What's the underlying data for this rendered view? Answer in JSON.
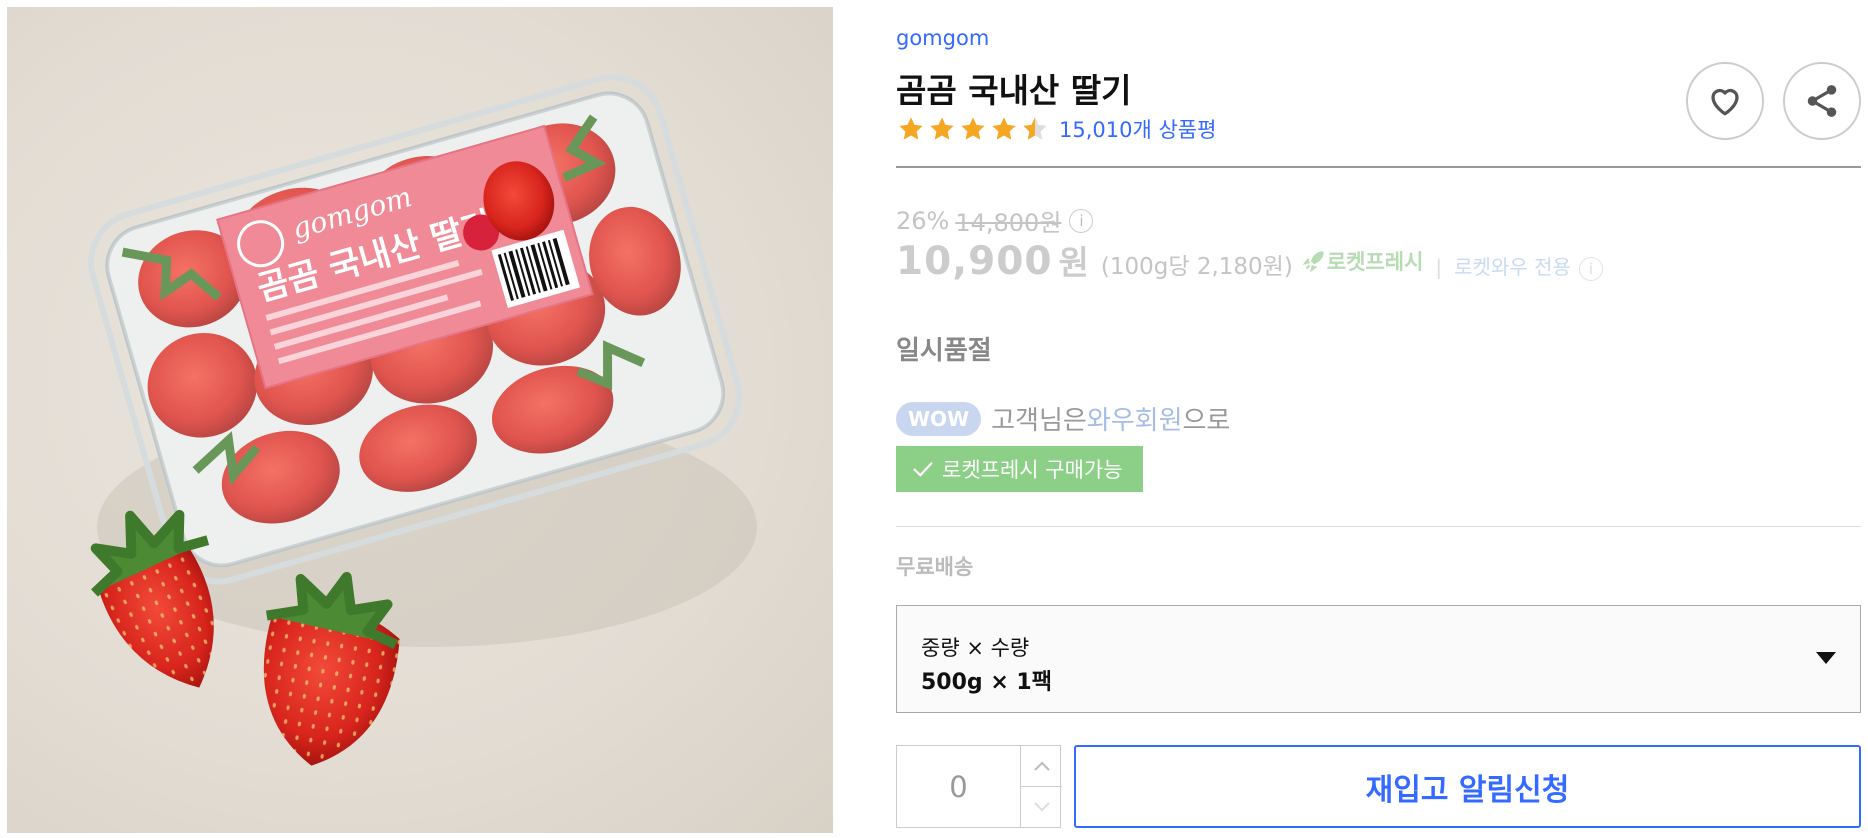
{
  "product_image": {
    "alt": "곰곰 국내산 딸기 500g 상품 이미지"
  },
  "product": {
    "brand": "gomgom",
    "title": "곰곰 국내산 딸기",
    "rating": 4.5,
    "review_count": "15,010개 상품평"
  },
  "price": {
    "discount_rate": "26%",
    "original_price": "14,800원",
    "info_icon": "i",
    "sale_price": "10,900",
    "won": "원",
    "unit_price": "(100g당 2,180원)",
    "rocket_fresh": "로켓프레시",
    "wow_only": "로켓와우 전용"
  },
  "status": {
    "soldout": "일시품절"
  },
  "wow": {
    "badge": "WOW",
    "text_before": "고객님은 ",
    "member": "와우회원",
    "text_after": "으로"
  },
  "fresh_available": "로켓프레시 구매가능",
  "shipping": "무료배송",
  "option": {
    "label": "중량 × 수량",
    "value": "500g × 1팩"
  },
  "quantity": {
    "value": "0"
  },
  "restock_button": "재입고 알림신청",
  "colors": {
    "brand_blue": "#346aff",
    "star": "#f5a623",
    "fresh_green": "#8ccf86"
  },
  "icons": [
    "heart-icon",
    "share-icon",
    "info-icon",
    "rocket-icon",
    "check-icon",
    "chevron-up-icon",
    "chevron-down-icon",
    "caret-down-icon"
  ]
}
